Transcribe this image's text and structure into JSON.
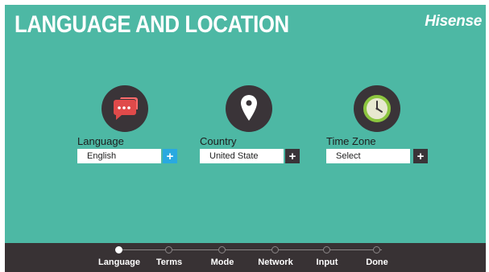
{
  "header": {
    "title": "LANGUAGE AND LOCATION",
    "brand": "Hisense"
  },
  "settings": [
    {
      "label": "Language",
      "value": "English",
      "plus_color": "#29a9e0",
      "icon": "chat-bubbles-icon"
    },
    {
      "label": "Country",
      "value": "United State",
      "plus_color": "#3a3438",
      "icon": "map-pin-icon"
    },
    {
      "label": "Time Zone",
      "value": "Select",
      "plus_color": "#3a3438",
      "icon": "clock-icon"
    }
  ],
  "plus_symbol": "+",
  "steps": [
    "Language",
    "Terms",
    "Mode",
    "Network",
    "Input",
    "Done"
  ],
  "active_step": "Language",
  "colors": {
    "background": "#4db8a4",
    "footer": "#383234",
    "icon_circle": "#3a3438",
    "accent_blue": "#29a9e0",
    "chat_red": "#e04a4a",
    "clock_green": "#8dc63f"
  }
}
